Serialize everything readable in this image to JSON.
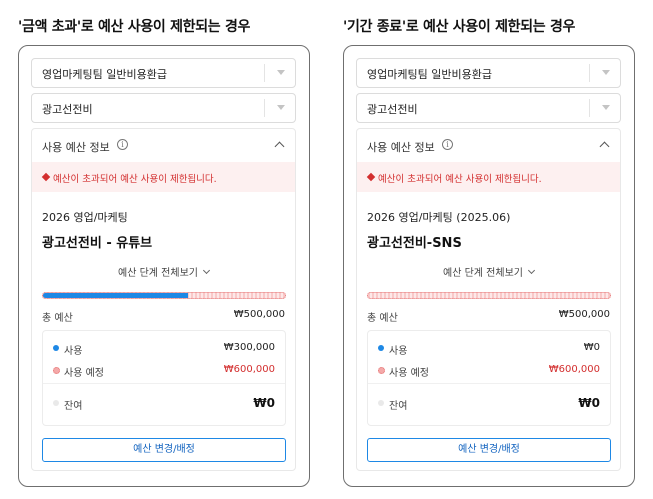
{
  "colors": {
    "accent": "#1e88e5",
    "error": "#d32f2f",
    "planned": "#f4a9a9"
  },
  "left": {
    "heading": "'금액 초과'로 예산 사용이 제한되는 경우",
    "select1": "영업마케팅팀 일반비용환급",
    "select2": "광고선전비",
    "panel_title": "사용 예산 정보",
    "info_icon": "i",
    "alert": "예산이 초과되어 예산 사용이 제한됩니다.",
    "subtitle": "2026 영업/마케팅",
    "budget_name": "광고선전비 - 유튜브",
    "view_all": "예산 단계 전체보기",
    "used_ratio": 0.6,
    "total_label": "총 예산",
    "total_value": "₩500,000",
    "used_label": "사용",
    "used_value": "₩300,000",
    "planned_label": "사용 예정",
    "planned_value": "₩600,000",
    "remaining_label": "잔여",
    "remaining_value": "₩0",
    "button": "예산 변경/배정"
  },
  "right": {
    "heading": "'기간 종료'로 예산 사용이 제한되는 경우",
    "select1": "영업마케팅팀 일반비용환급",
    "select2": "광고선전비",
    "panel_title": "사용 예산 정보",
    "info_icon": "i",
    "alert": "예산이 초과되어 예산 사용이 제한됩니다.",
    "subtitle": "2026 영업/마케팅 (2025.06)",
    "budget_name": "광고선전비-SNS",
    "view_all": "예산 단계 전체보기",
    "used_ratio": 0,
    "total_label": "총 예산",
    "total_value": "₩500,000",
    "used_label": "사용",
    "used_value": "₩0",
    "planned_label": "사용 예정",
    "planned_value": "₩600,000",
    "remaining_label": "잔여",
    "remaining_value": "₩0",
    "button": "예산 변경/배정"
  }
}
